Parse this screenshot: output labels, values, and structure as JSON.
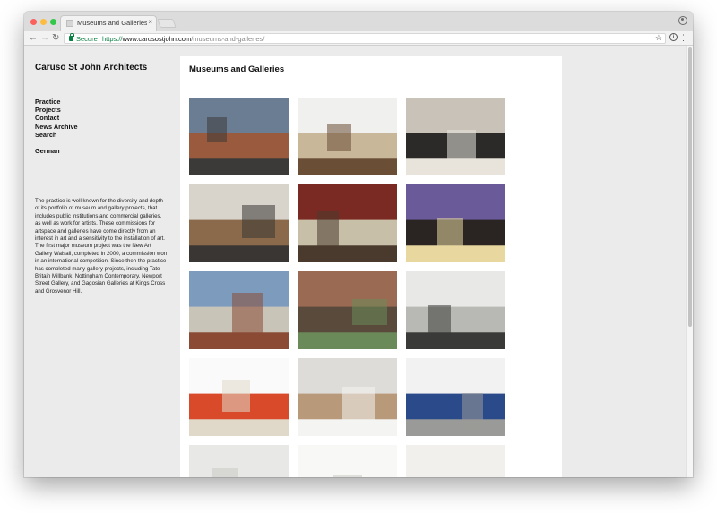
{
  "browser": {
    "tab_title": "Museums and Galleries « Caru",
    "tab_close": "×",
    "secure_label": "Secure",
    "url_scheme": "https://",
    "url_host": "www.carusostjohn.com",
    "url_path": "/museums-and-galleries/"
  },
  "site": {
    "title": "Caruso St John Architects",
    "nav": [
      "Practice",
      "Projects",
      "Contact",
      "News Archive",
      "Search"
    ],
    "language_link": "German",
    "intro": "The practice is well known for the diversity and depth of its portfolio of museum and gallery projects, that includes public institutions and commercial galleries, as well as work for artists. These commissions for artspace and galleries have come directly from an interest in art and a sensitivity to the installation of art. The first major museum project was the New Art Gallery Walsall, completed in 2000, a commission won in an international competition. Since then the practice has completed many gallery projects, including Tate Britain Millbank, Nottingham Contemporary, Newport Street Gallery, and Gagosian Galleries at Kings Cross and Grosvenor Hill."
  },
  "content": {
    "title": "Museums and Galleries",
    "thumbnails": [
      {
        "name": "brick-gallery-exterior",
        "colors": [
          "#6b7d93",
          "#9a5a3e",
          "#3c3a38"
        ]
      },
      {
        "name": "white-gallery-interior",
        "colors": [
          "#f0f0ee",
          "#c9b79a",
          "#6a4e36"
        ]
      },
      {
        "name": "patterned-floor-stair",
        "colors": [
          "#c8c2b8",
          "#2b2a28",
          "#e8e4dc"
        ]
      },
      {
        "name": "timber-room-interior",
        "colors": [
          "#d8d4cc",
          "#8a6a4a",
          "#3a3634"
        ]
      },
      {
        "name": "red-museum-room",
        "colors": [
          "#7a2a22",
          "#c8bfa8",
          "#4a3a2e"
        ]
      },
      {
        "name": "gallery-at-dusk",
        "colors": [
          "#6a5a9a",
          "#2a2422",
          "#e8d8a0"
        ]
      },
      {
        "name": "nottingham-contemporary",
        "colors": [
          "#7d9bbd",
          "#c8c4b8",
          "#8a4a34"
        ]
      },
      {
        "name": "brick-arches-facade",
        "colors": [
          "#9a6a52",
          "#5a4a3c",
          "#6a8a5a"
        ]
      },
      {
        "name": "skylight-gallery",
        "colors": [
          "#e8e8e6",
          "#b8b8b4",
          "#3a3a38"
        ]
      },
      {
        "name": "red-painting-gallery",
        "colors": [
          "#fafafa",
          "#d84a2a",
          "#e0d8c8"
        ]
      },
      {
        "name": "sculpture-gallery",
        "colors": [
          "#dedcd8",
          "#b89a7a",
          "#f4f4f2"
        ]
      },
      {
        "name": "blue-sculpture-gallery",
        "colors": [
          "#f2f2f2",
          "#2a4a8a",
          "#9a9a98"
        ]
      },
      {
        "name": "columned-gallery",
        "colors": [
          "#e8e8e6",
          "#5a5a58",
          "#c8c8c4"
        ]
      },
      {
        "name": "bright-gallery",
        "colors": [
          "#f8f8f6",
          "#5a8a3a",
          "#c8c8c4"
        ]
      },
      {
        "name": "ceiling-gallery",
        "colors": [
          "#f2f0ec",
          "#a87a5a",
          "#d8d4cc"
        ]
      }
    ]
  }
}
